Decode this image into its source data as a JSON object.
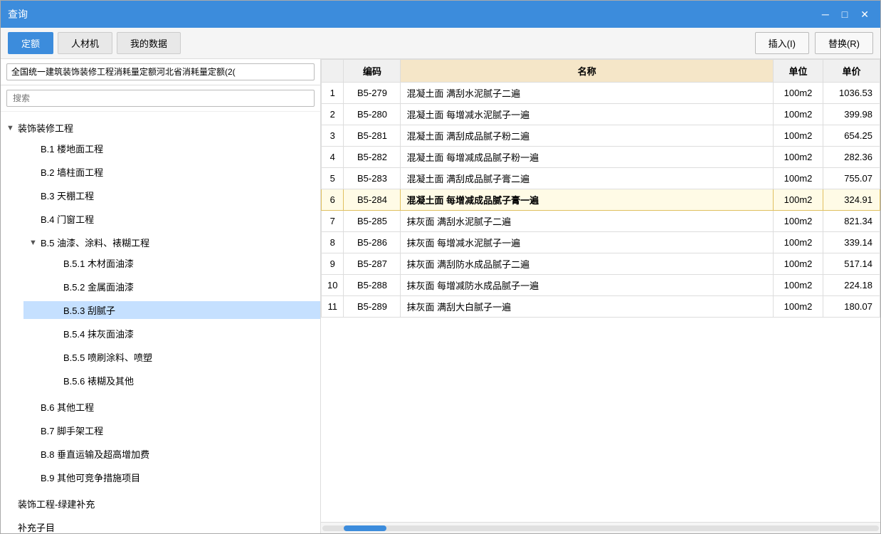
{
  "window": {
    "title": "查询",
    "minimize_label": "─",
    "maximize_label": "□",
    "close_label": "✕"
  },
  "tabs": [
    {
      "id": "dinge",
      "label": "定额",
      "active": true
    },
    {
      "id": "rencaiji",
      "label": "人材机",
      "active": false
    },
    {
      "id": "wodedata",
      "label": "我的数据",
      "active": false
    }
  ],
  "buttons": {
    "insert": "插入(I)",
    "replace": "替换(R)"
  },
  "dropdown": {
    "value": "全国统一建筑装饰装修工程消耗量定额河北省消耗量定额(2(",
    "placeholder": "全国统一建筑装饰装修工程消耗量定额河北省消耗量定额(2("
  },
  "search": {
    "placeholder": "搜索"
  },
  "tree": [
    {
      "label": "装饰装修工程",
      "expanded": true,
      "level": 0,
      "children": [
        {
          "label": "B.1 楼地面工程",
          "level": 1,
          "expanded": false,
          "children": []
        },
        {
          "label": "B.2 墙柱面工程",
          "level": 1,
          "expanded": false,
          "children": []
        },
        {
          "label": "B.3 天棚工程",
          "level": 1,
          "expanded": false,
          "children": []
        },
        {
          "label": "B.4 门窗工程",
          "level": 1,
          "expanded": false,
          "children": []
        },
        {
          "label": "B.5 油漆、涂料、裱糊工程",
          "level": 1,
          "expanded": true,
          "children": [
            {
              "label": "B.5.1 木材面油漆",
              "level": 2,
              "expanded": false,
              "children": []
            },
            {
              "label": "B.5.2 金属面油漆",
              "level": 2,
              "expanded": false,
              "children": []
            },
            {
              "label": "B.5.3 刮腻子",
              "level": 2,
              "selected": true,
              "children": []
            },
            {
              "label": "B.5.4 抹灰面油漆",
              "level": 2,
              "children": []
            },
            {
              "label": "B.5.5 喷刷涂料、喷塑",
              "level": 2,
              "children": []
            },
            {
              "label": "B.5.6 裱糊及其他",
              "level": 2,
              "children": []
            }
          ]
        },
        {
          "label": "B.6 其他工程",
          "level": 1,
          "expanded": false,
          "children": []
        },
        {
          "label": "B.7 脚手架工程",
          "level": 1,
          "expanded": false,
          "children": []
        },
        {
          "label": "B.8 垂直运输及超高增加费",
          "level": 1,
          "expanded": false,
          "children": []
        },
        {
          "label": "B.9 其他可竞争措施项目",
          "level": 1,
          "expanded": false,
          "children": []
        }
      ]
    },
    {
      "label": "装饰工程-绿建补充",
      "level": 0,
      "expanded": false,
      "children": []
    },
    {
      "label": "补充子目",
      "level": 0,
      "expanded": false,
      "children": []
    }
  ],
  "table": {
    "columns": [
      "",
      "编码",
      "名称",
      "单位",
      "单价"
    ],
    "rows": [
      {
        "num": "1",
        "code": "B5-279",
        "name": "混凝土面  满刮水泥腻子二遍",
        "unit": "100m2",
        "price": "1036.53",
        "selected": false
      },
      {
        "num": "2",
        "code": "B5-280",
        "name": "混凝土面  每增减水泥腻子一遍",
        "unit": "100m2",
        "price": "399.98",
        "selected": false
      },
      {
        "num": "3",
        "code": "B5-281",
        "name": "混凝土面  满刮成品腻子粉二遍",
        "unit": "100m2",
        "price": "654.25",
        "selected": false
      },
      {
        "num": "4",
        "code": "B5-282",
        "name": "混凝土面  每增减成品腻子粉一遍",
        "unit": "100m2",
        "price": "282.36",
        "selected": false
      },
      {
        "num": "5",
        "code": "B5-283",
        "name": "混凝土面  满刮成品腻子膏二遍",
        "unit": "100m2",
        "price": "755.07",
        "selected": false
      },
      {
        "num": "6",
        "code": "B5-284",
        "name": "混凝土面  每增减成品腻子膏一遍",
        "unit": "100m2",
        "price": "324.91",
        "selected": true
      },
      {
        "num": "7",
        "code": "B5-285",
        "name": "抹灰面  满刮水泥腻子二遍",
        "unit": "100m2",
        "price": "821.34",
        "selected": false
      },
      {
        "num": "8",
        "code": "B5-286",
        "name": "抹灰面  每增减水泥腻子一遍",
        "unit": "100m2",
        "price": "339.14",
        "selected": false
      },
      {
        "num": "9",
        "code": "B5-287",
        "name": "抹灰面  满刮防水成品腻子二遍",
        "unit": "100m2",
        "price": "517.14",
        "selected": false
      },
      {
        "num": "10",
        "code": "B5-288",
        "name": "抹灰面  每增减防水成品腻子一遍",
        "unit": "100m2",
        "price": "224.18",
        "selected": false
      },
      {
        "num": "11",
        "code": "B5-289",
        "name": "抹灰面  满刮大白腻子一遍",
        "unit": "100m2",
        "price": "180.07",
        "selected": false
      }
    ]
  }
}
